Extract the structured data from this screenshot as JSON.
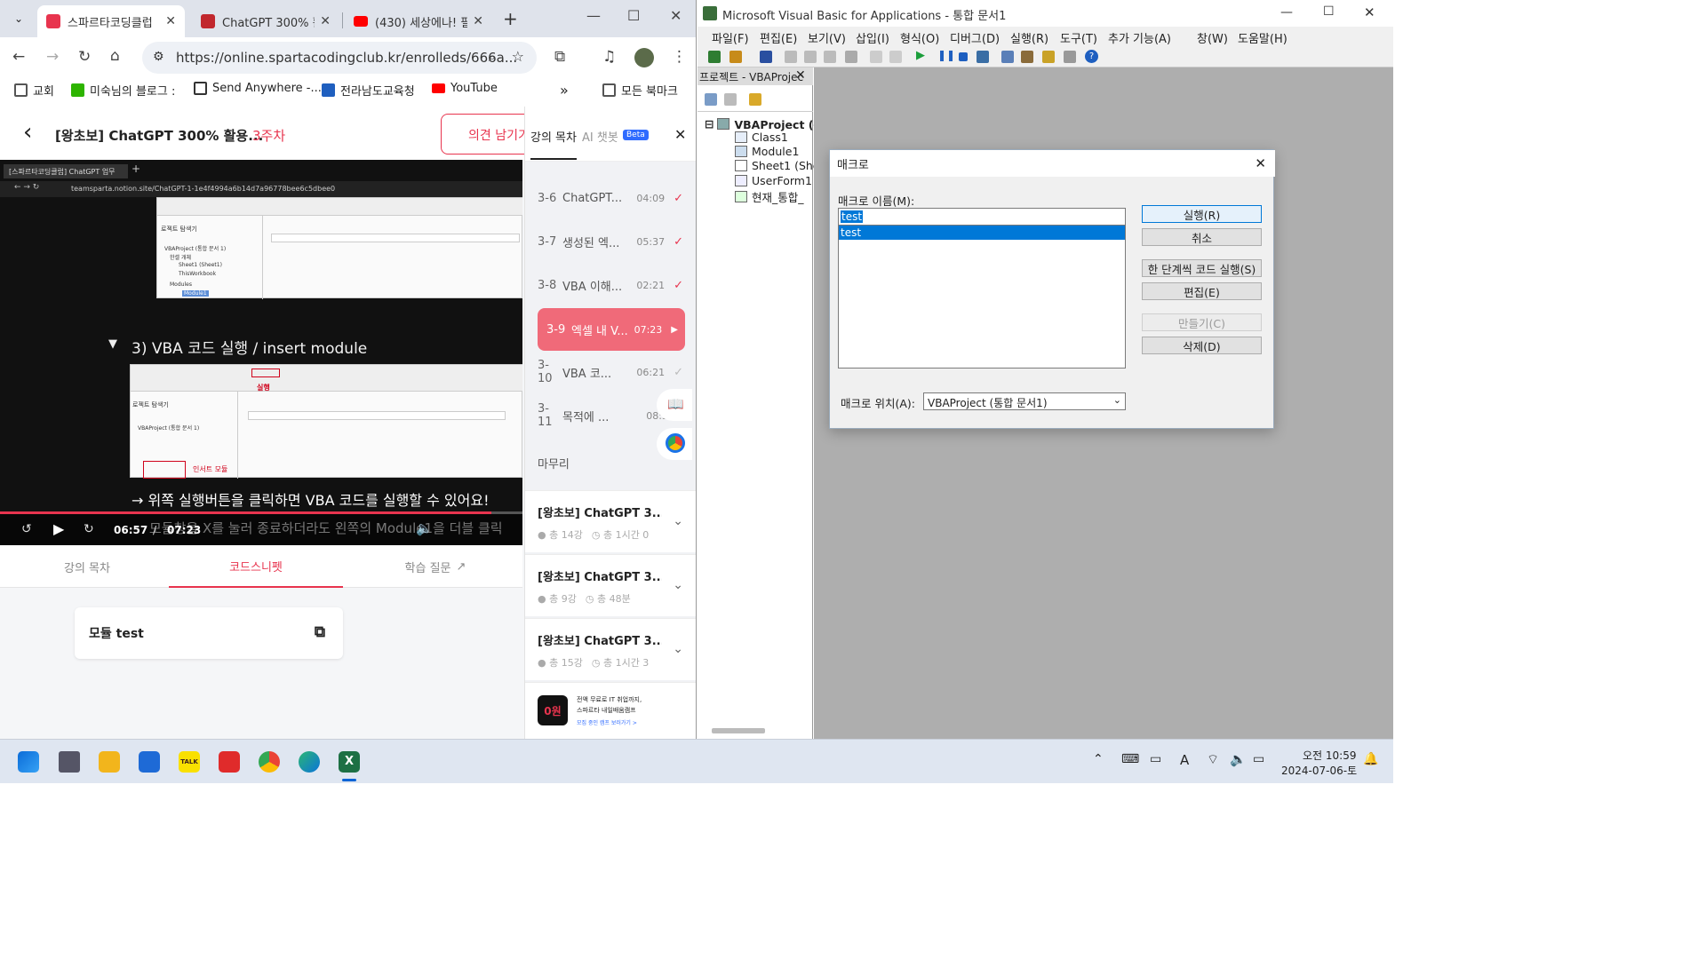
{
  "chrome": {
    "tabs": [
      {
        "title": "스파르타코딩클럽",
        "active": true,
        "color": "#e8344e"
      },
      {
        "title": "ChatGPT 300% 활",
        "active": false,
        "color": "#c1272d"
      },
      {
        "title": "(430) 세상에나! 필",
        "active": false,
        "color": "#ff0000"
      }
    ],
    "new_tab": "+",
    "url": "https://online.spartacodingclub.kr/enrolleds/666a...",
    "bookmarks": [
      "교회",
      "미숙님의 블로그 :",
      "Send Anywhere -...",
      "전라남도교육청",
      "YouTube"
    ],
    "bookmarks_more": "»",
    "all_bookmarks": "모든 북마크"
  },
  "lecture": {
    "back": "‹",
    "title": "[왕초보] ChatGPT 300% 활용...",
    "week": "3주차",
    "feedback": "의견 남기기"
  },
  "video": {
    "inner_tab": "[스파르타코딩클럽] ChatGPT 업무",
    "inner_url": "teamsparta.notion.site/ChatGPT-1-1e4f4994a6b14d7a96778bee6c5dbee0",
    "heading": "3) VBA 코드 실행 / insert module",
    "red_label_1": "실행",
    "red_label_2": "인서트 모듈",
    "caption": "→ 위쪽 실행버튼을 클릭하면 VBA 코드를 실행할 수 있어요!",
    "overlay_text": "모듈창을 X를 눌러 종료하더라도 왼쪽의 Module1을 더블 클릭",
    "current_time": "06:57",
    "duration": "07:23",
    "progress": 0.94,
    "inner_project_title": "로젝트 탐색기",
    "inner_vbaproject": "VBAProject (통합 문서 1)",
    "inner_sheet": "Sheet1 (Sheet1)",
    "inner_workbook": "ThisWorkbook",
    "inner_modules": "Modules",
    "inner_module1": "Module1",
    "inner_excel_objects": "한셀 개체"
  },
  "lecture_tabs": [
    "강의 목차",
    "코드스니펫",
    "학습 질문"
  ],
  "snippet": {
    "title": "모듈 test"
  },
  "toc": {
    "tab_outline": "강의 목차",
    "tab_ai": "AI 챗봇",
    "beta": "Beta",
    "close": "✕",
    "items": [
      {
        "num": "3-6",
        "name": "ChatGPT...",
        "time": "04:09",
        "done": true
      },
      {
        "num": "3-7",
        "name": "생성된 엑...",
        "time": "05:37",
        "done": true
      },
      {
        "num": "3-8",
        "name": "VBA 이해...",
        "time": "02:21",
        "done": true
      },
      {
        "num": "3-9",
        "name": "엑셀 내 V...",
        "time": "07:23",
        "done": false
      },
      {
        "num": "3-10",
        "name": "VBA 코...",
        "time": "06:21",
        "done": false
      },
      {
        "num": "3-11",
        "name": "목적에 ...",
        "time": "08:35",
        "done": false
      }
    ],
    "finish": "마무리",
    "courses": [
      {
        "name": "[왕초보] ChatGPT 3...",
        "count": "총 14강",
        "time": "총 1시간 0"
      },
      {
        "name": "[왕초보] ChatGPT 3...",
        "count": "총 9강",
        "time": "총 48분"
      },
      {
        "name": "[왕초보] ChatGPT 3...",
        "count": "총 15강",
        "time": "총 1시간 3"
      }
    ],
    "ad_badge": "0원",
    "ad_line1": "전액 무료로 IT 취업까지,",
    "ad_line2": "스파르타 내일배움캠프",
    "ad_link": "모집 중인 캠프 보러가기 >"
  },
  "vba": {
    "title": "Microsoft Visual Basic for Applications - 통합 문서1",
    "menu": [
      "파일(F)",
      "편집(E)",
      "보기(V)",
      "삽입(I)",
      "형식(O)",
      "디버그(D)",
      "실행(R)",
      "도구(T)",
      "추가 기능(A)",
      "창(W)",
      "도움말(H)"
    ],
    "project_title": "프로젝트 - VBAProjec",
    "tree": [
      "VBAProject (통",
      "Class1",
      "Module1",
      "Sheet1 (She",
      "UserForm1",
      "현재_통합_"
    ]
  },
  "dialog": {
    "title": "매크로",
    "name_label": "매크로 이름(M):",
    "name_value": "test",
    "list": [
      "test"
    ],
    "buttons": [
      "실행(R)",
      "취소",
      "한 단계씩 코드 실행(S)",
      "편집(E)",
      "만들기(C)",
      "삭제(D)"
    ],
    "location_label": "매크로 위치(A):",
    "location_value": "VBAProject (통합 문서1)"
  },
  "taskbar": {
    "time": "오전 10:59",
    "date": "2024-07-06-토",
    "ime": "A"
  }
}
